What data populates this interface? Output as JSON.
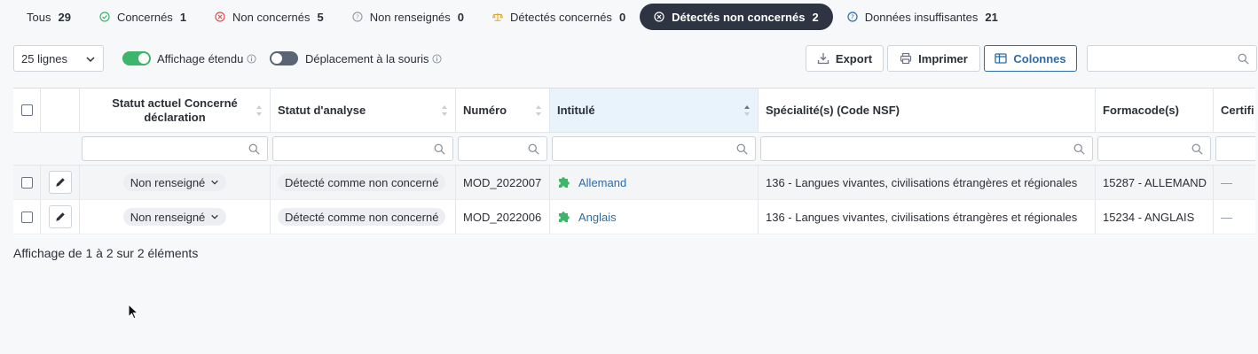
{
  "tabs": [
    {
      "label": "Tous",
      "count": "29",
      "icon": "none"
    },
    {
      "label": "Concernés",
      "count": "1",
      "icon": "check-circle-icon"
    },
    {
      "label": "Non concernés",
      "count": "5",
      "icon": "x-circle-icon"
    },
    {
      "label": "Non renseignés",
      "count": "0",
      "icon": "question-circle-icon"
    },
    {
      "label": "Détectés concernés",
      "count": "0",
      "icon": "balance-scale-icon"
    },
    {
      "label": "Détectés non concernés",
      "count": "2",
      "icon": "x-circle-icon",
      "active": true
    },
    {
      "label": "Données insuffisantes",
      "count": "21",
      "icon": "question-circle-icon"
    }
  ],
  "toolbar": {
    "rows_select": "25 lignes",
    "toggle_extended_label": "Affichage étendu",
    "toggle_mouse_label": "Déplacement à la souris",
    "export_label": "Export",
    "print_label": "Imprimer",
    "columns_label": "Colonnes",
    "search_placeholder": ""
  },
  "table": {
    "headers": {
      "statut_actuel": "Statut actuel Concerné déclaration",
      "statut_analyse": "Statut d'analyse",
      "numero": "Numéro",
      "intitule": "Intitulé",
      "specialites": "Spécialité(s) (Code NSF)",
      "formacode": "Formacode(s)",
      "certif": "Certifi"
    },
    "rows": [
      {
        "statut_actuel": "Non renseigné",
        "statut_analyse": "Détecté comme non concerné",
        "numero": "MOD_2022007",
        "intitule": "Allemand",
        "specialites": "136 - Langues vivantes, civilisations étrangères et régionales",
        "formacode": "15287 - ALLEMAND",
        "certif": "—"
      },
      {
        "statut_actuel": "Non renseigné",
        "statut_analyse": "Détecté comme non concerné",
        "numero": "MOD_2022006",
        "intitule": "Anglais",
        "specialites": "136 - Langues vivantes, civilisations étrangères et régionales",
        "formacode": "15234 - ANGLAIS",
        "certif": "—"
      }
    ]
  },
  "footer": {
    "text": "Affichage de 1 à 2 sur 2 éléments"
  },
  "colors": {
    "accent": "#2d6ca8",
    "active_tab": "#2e3442",
    "toggle_on": "#3db56a",
    "puzzle": "#3db56a"
  }
}
